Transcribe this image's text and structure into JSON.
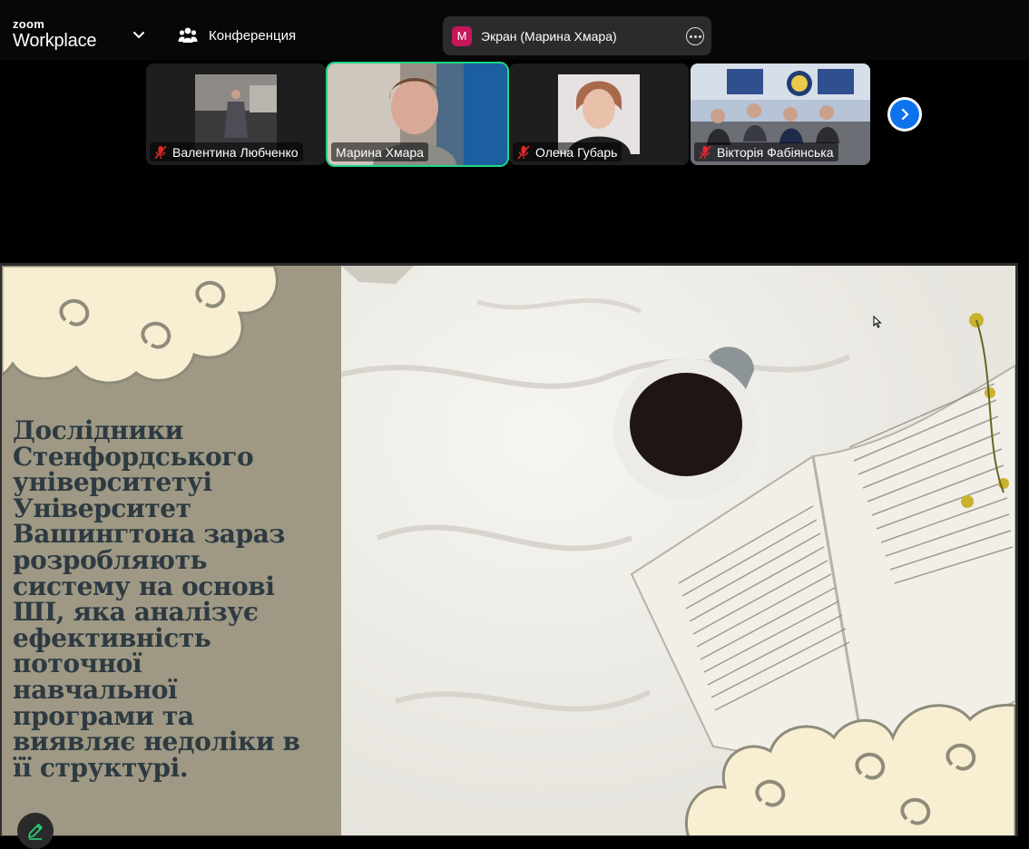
{
  "app": {
    "logo_top": "zoom",
    "logo_bottom": "Workplace",
    "meeting_label": "Конференция",
    "share_pill": {
      "avatar_letter": "M",
      "label": "Экран (Марина Хмара)"
    }
  },
  "participants": [
    {
      "name": "Валентина Любченко",
      "muted": true,
      "active": false
    },
    {
      "name": "Марина Хмара",
      "muted": false,
      "active": true
    },
    {
      "name": "Олена Губарь",
      "muted": true,
      "active": false
    },
    {
      "name": "Вікторія Фабіянська",
      "muted": true,
      "active": false
    }
  ],
  "slide": {
    "lines": [
      "Дослідники",
      "Стенфордського",
      "університетуі",
      "Університет",
      "Вашингтона зараз",
      "розробляють",
      "систему на основі",
      "ШІ, яка аналізує",
      "ефективність",
      "поточної",
      "навчальної",
      "програми та",
      "виявляє недоліки в",
      "її структурі."
    ]
  },
  "icons": {
    "dropdown": "chevron-down-icon",
    "participants": "people-icon",
    "more": "more-options-icon",
    "muted_mic": "muted-mic-icon",
    "next": "chevron-right-icon",
    "annotate": "pencil-icon"
  },
  "colors": {
    "active_border": "#1ed782",
    "muted_icon": "#e02828",
    "share_avatar": "#c5175a",
    "next_button": "#0e72ed",
    "slide_panel": "#9e9884",
    "slide_text": "#2d3a41",
    "cloud_fill": "#f8eed2"
  }
}
